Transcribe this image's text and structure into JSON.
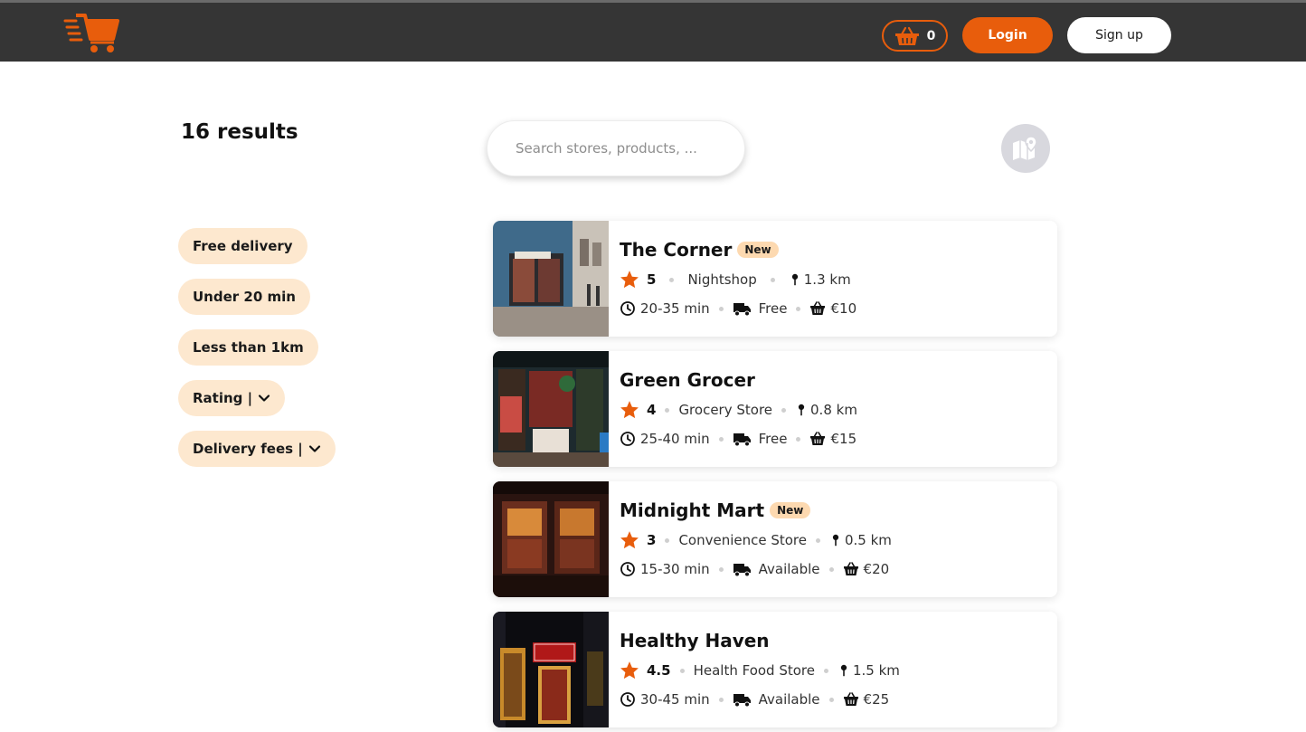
{
  "header": {
    "cart_count": "0",
    "login_label": "Login",
    "signup_label": "Sign up",
    "accent_color": "#e85d0c"
  },
  "results": {
    "label": "16 results"
  },
  "search": {
    "placeholder": "Search stores, products, ..."
  },
  "filters": [
    {
      "label": "Free delivery",
      "dropdown": false
    },
    {
      "label": "Under 20 min",
      "dropdown": false
    },
    {
      "label": "Less than 1km",
      "dropdown": false
    },
    {
      "label": "Rating |",
      "dropdown": true
    },
    {
      "label": "Delivery fees |",
      "dropdown": true
    }
  ],
  "stores": [
    {
      "name": "The Corner",
      "badge": "New",
      "rating": "5",
      "category": "Nightshop",
      "distance": "1.3 km",
      "time": "20-35 min",
      "delivery": "Free",
      "min_order": "€10"
    },
    {
      "name": "Green Grocer",
      "badge": "",
      "rating": "4",
      "category": "Grocery Store",
      "distance": "0.8 km",
      "time": "25-40 min",
      "delivery": "Free",
      "min_order": "€15"
    },
    {
      "name": "Midnight Mart",
      "badge": "New",
      "rating": "3",
      "category": "Convenience Store",
      "distance": "0.5 km",
      "time": "15-30 min",
      "delivery": "Available",
      "min_order": "€20"
    },
    {
      "name": "Healthy Haven",
      "badge": "",
      "rating": "4.5",
      "category": "Health Food Store",
      "distance": "1.5 km",
      "time": "30-45 min",
      "delivery": "Available",
      "min_order": "€25"
    }
  ]
}
